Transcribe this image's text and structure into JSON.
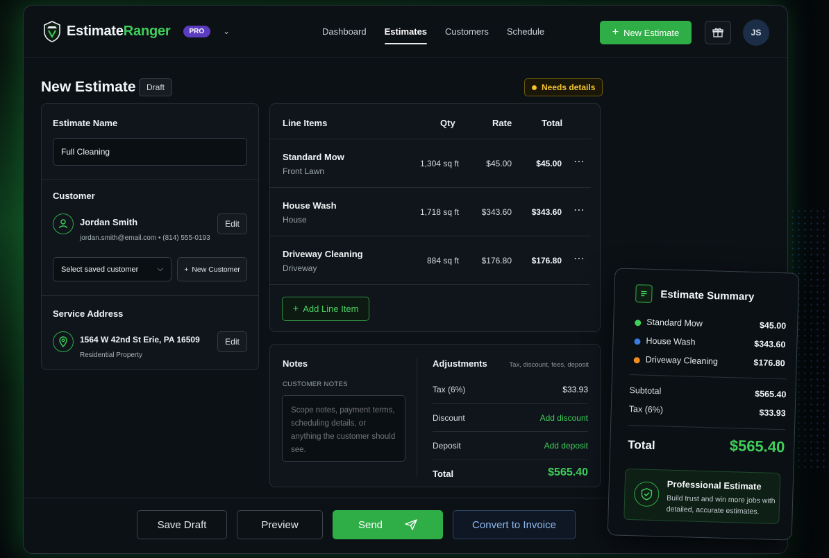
{
  "brand": {
    "name_a": "Estimate",
    "name_b": "Ranger",
    "badge": "PRO"
  },
  "nav": {
    "items": [
      "Dashboard",
      "Estimates",
      "Customers",
      "Schedule"
    ],
    "active": "Estimates"
  },
  "header": {
    "new_estimate": "New Estimate",
    "avatar_initials": "JS"
  },
  "page": {
    "title": "New Estimate",
    "status_badge": "Draft",
    "warning_badge": "Needs details"
  },
  "estimate_name": {
    "label": "Estimate Name",
    "value": "Full Cleaning"
  },
  "customer": {
    "label": "Customer",
    "name": "Jordan Smith",
    "contact": "jordan.smith@email.com • (814) 555-0193",
    "edit_label": "Edit",
    "select_placeholder": "Select saved customer",
    "new_customer_label": "New Customer"
  },
  "service_address": {
    "label": "Service Address",
    "address": "1564 W 42nd St Erie, PA 16509",
    "type": "Residential Property",
    "edit_label": "Edit"
  },
  "line_items": {
    "headers": {
      "item": "Line Items",
      "qty": "Qty",
      "rate": "Rate",
      "total": "Total"
    },
    "rows": [
      {
        "name": "Standard Mow",
        "sub": "Front Lawn",
        "qty": "1,304 sq ft",
        "rate": "$45.00",
        "total": "$45.00"
      },
      {
        "name": "House Wash",
        "sub": "House",
        "qty": "1,718 sq ft",
        "rate": "$343.60",
        "total": "$343.60"
      },
      {
        "name": "Driveway Cleaning",
        "sub": "Driveway",
        "qty": "884 sq ft",
        "rate": "$176.80",
        "total": "$176.80"
      }
    ],
    "add_label": "Add Line Item"
  },
  "notes": {
    "title": "Notes",
    "label": "CUSTOMER NOTES",
    "placeholder": "Scope notes, payment terms, scheduling details, or anything the customer should see."
  },
  "adjustments": {
    "title": "Adjustments",
    "hint": "Tax, discount, fees, deposit",
    "tax_label": "Tax (6%)",
    "tax_value": "$33.93",
    "discount_label": "Discount",
    "discount_action": "Add discount",
    "deposit_label": "Deposit",
    "deposit_action": "Add deposit",
    "total_label": "Total",
    "total_value": "$565.40"
  },
  "footer": {
    "save_draft": "Save Draft",
    "preview": "Preview",
    "send": "Send",
    "convert": "Convert to Invoice"
  },
  "summary": {
    "title": "Estimate Summary",
    "items": [
      {
        "name": "Standard Mow",
        "amount": "$45.00",
        "color": "#3fcf5a"
      },
      {
        "name": "House Wash",
        "amount": "$343.60",
        "color": "#3b7be0"
      },
      {
        "name": "Driveway Cleaning",
        "amount": "$176.80",
        "color": "#f28c1f"
      }
    ],
    "subtotal_label": "Subtotal",
    "subtotal": "$565.40",
    "tax_label": "Tax (6%)",
    "tax": "$33.93",
    "total_label": "Total",
    "total": "$565.40",
    "promo_title": "Professional Estimate",
    "promo_text": "Build trust and win more jobs with detailed, accurate estimates."
  },
  "colors": {
    "accent_green": "#2fae47",
    "warning_yellow": "#f1c232",
    "pro_purple": "#5b3bbf"
  }
}
